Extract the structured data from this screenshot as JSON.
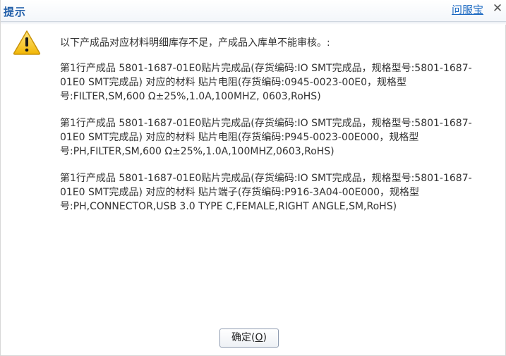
{
  "dialog": {
    "title": "提示",
    "help_link": "问服宝",
    "close_glyph": "✕"
  },
  "message": {
    "intro": "以下产成品对应材料明细库存不足，产成品入库单不能审核。:",
    "items": [
      "第1行产成品 5801-1687-01E0贴片完成品(存货编码:IO SMT完成品，规格型号:5801-1687-01E0 SMT完成品) 对应的材料 贴片电阻(存货编码:0945-0023-00E0，规格型号:FILTER,SM,600 Ω±25%,1.0A,100MHZ, 0603,RoHS)",
      "第1行产成品 5801-1687-01E0贴片完成品(存货编码:IO SMT完成品，规格型号:5801-1687-01E0 SMT完成品) 对应的材料 贴片电阻(存货编码:P945-0023-00E000，规格型号:PH,FILTER,SM,600 Ω±25%,1.0A,100MHZ,0603,RoHS)",
      "第1行产成品 5801-1687-01E0贴片完成品(存货编码:IO SMT完成品，规格型号:5801-1687-01E0 SMT完成品) 对应的材料 贴片端子(存货编码:P916-3A04-00E000，规格型号:PH,CONNECTOR,USB 3.0 TYPE C,FEMALE,RIGHT ANGLE,SM,RoHS)"
    ]
  },
  "buttons": {
    "ok_label": "确定(",
    "ok_key": "O",
    "ok_suffix": ")"
  },
  "icons": {
    "warning": "warning-triangle",
    "warning_color": "#f5c518"
  },
  "colors": {
    "title": "#1f5da8",
    "link": "#1565c0",
    "text": "#333333"
  }
}
